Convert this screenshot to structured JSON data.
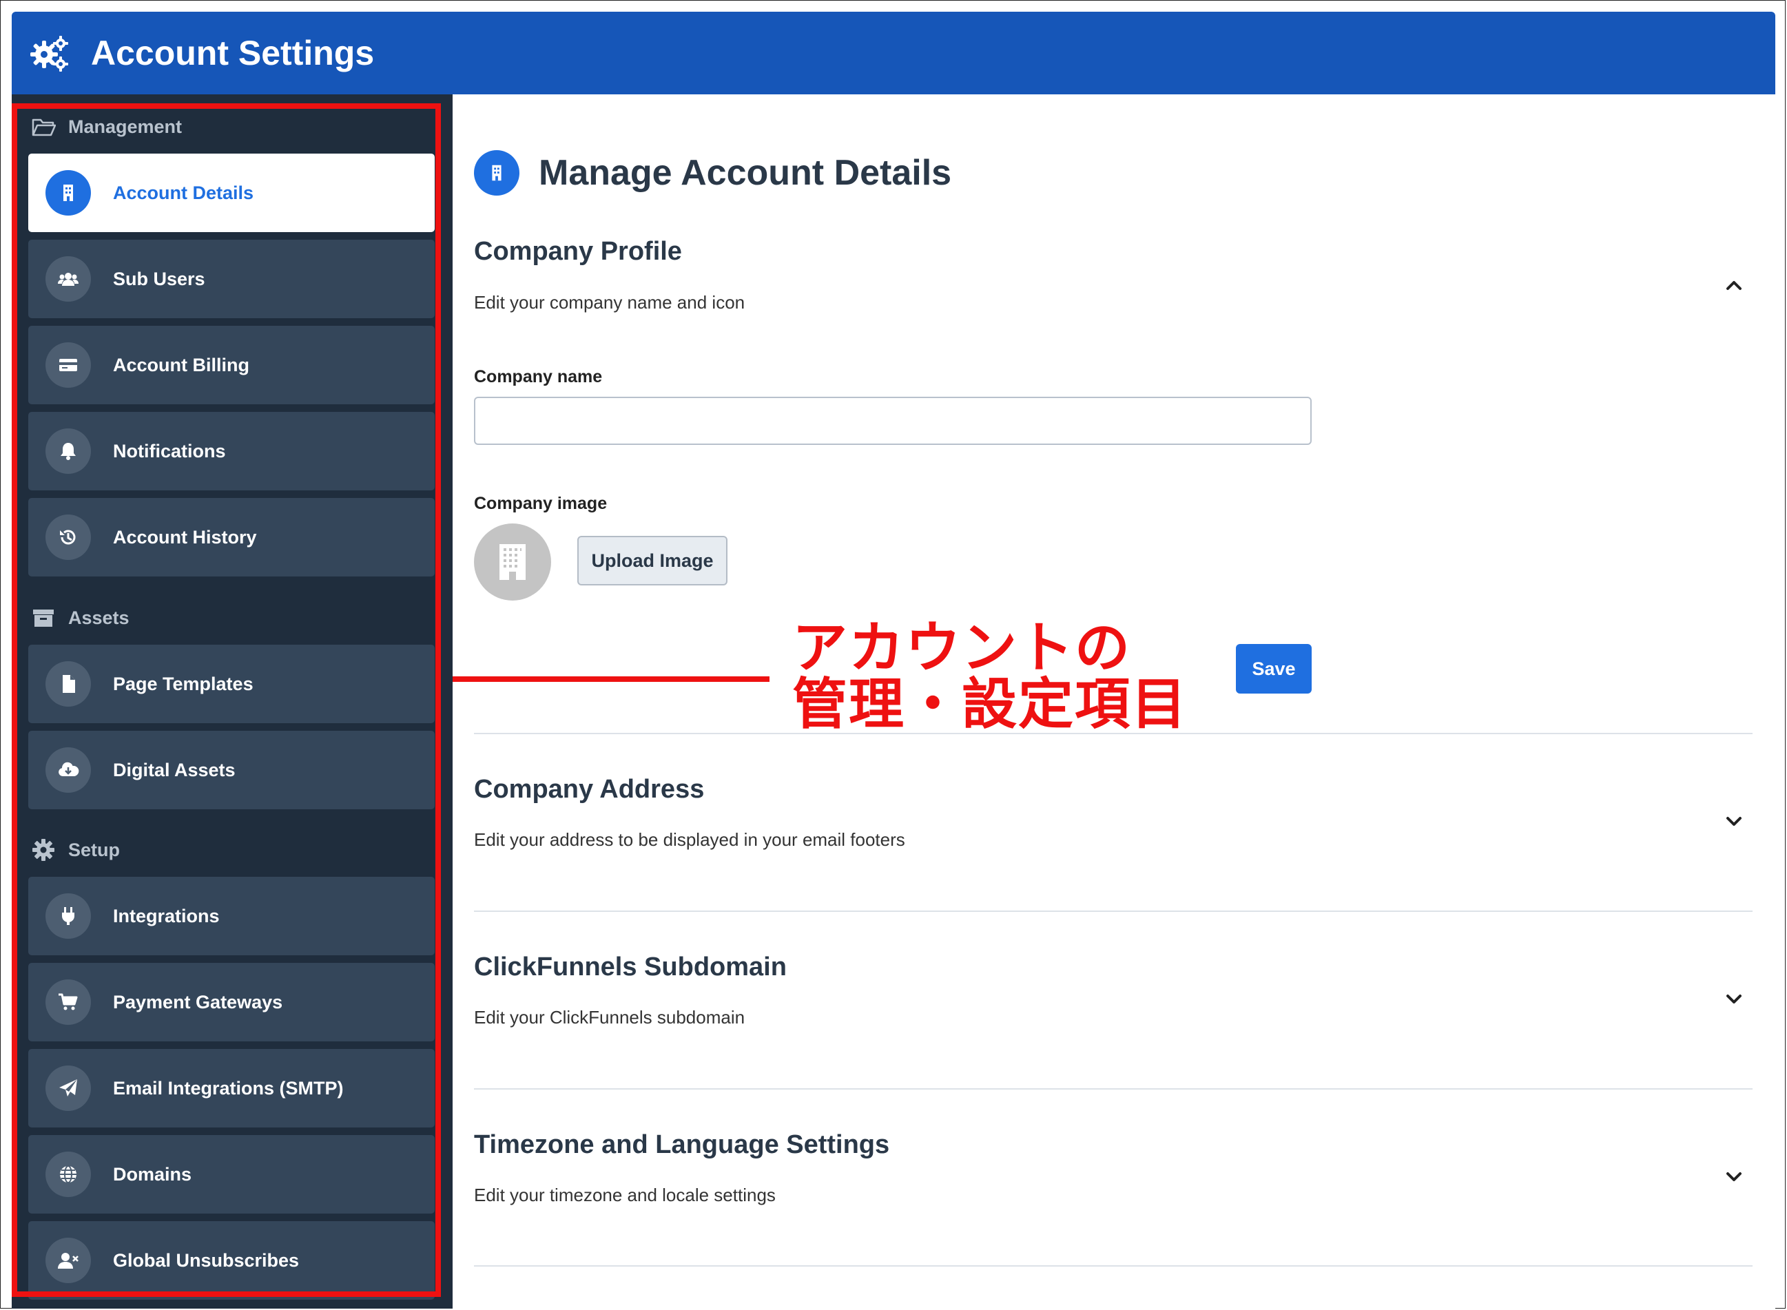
{
  "header": {
    "title": "Account Settings",
    "icon": "gears-icon"
  },
  "sidebar": {
    "sections": [
      {
        "label": "Management",
        "icon": "folder-open-icon"
      },
      {
        "label": "Assets",
        "icon": "archive-icon"
      },
      {
        "label": "Setup",
        "icon": "gear-icon"
      }
    ],
    "items": [
      {
        "label": "Account Details",
        "icon": "building-icon",
        "active": true
      },
      {
        "label": "Sub Users",
        "icon": "users-icon"
      },
      {
        "label": "Account Billing",
        "icon": "credit-card-icon"
      },
      {
        "label": "Notifications",
        "icon": "bell-icon"
      },
      {
        "label": "Account History",
        "icon": "history-icon"
      },
      {
        "label": "Page Templates",
        "icon": "file-icon"
      },
      {
        "label": "Digital Assets",
        "icon": "cloud-download-icon"
      },
      {
        "label": "Integrations",
        "icon": "plug-icon"
      },
      {
        "label": "Payment Gateways",
        "icon": "cart-icon"
      },
      {
        "label": "Email Integrations (SMTP)",
        "icon": "paper-plane-icon"
      },
      {
        "label": "Domains",
        "icon": "globe-icon"
      },
      {
        "label": "Global Unsubscribes",
        "icon": "user-times-icon"
      }
    ]
  },
  "main": {
    "title": "Manage Account Details",
    "title_icon": "building-icon",
    "sections": [
      {
        "title": "Company Profile",
        "desc": "Edit your company name and icon",
        "expanded": true
      },
      {
        "title": "Company Address",
        "desc": "Edit your address to be displayed in your email footers",
        "expanded": false
      },
      {
        "title": "ClickFunnels Subdomain",
        "desc": "Edit your ClickFunnels subdomain",
        "expanded": false
      },
      {
        "title": "Timezone and Language Settings",
        "desc": "Edit your timezone and locale settings",
        "expanded": false
      }
    ],
    "company_name_label": "Company name",
    "company_name_value": "",
    "company_image_label": "Company image",
    "upload_label": "Upload Image",
    "save_label": "Save"
  },
  "annotation": {
    "line1": "アカウントの",
    "line2": "管理・設定項目",
    "color": "#ee1111"
  },
  "colors": {
    "header": "#1656b8",
    "sidebar": "#1f2d3d",
    "nav_item": "#34465a",
    "accent": "#1f6fe0"
  }
}
